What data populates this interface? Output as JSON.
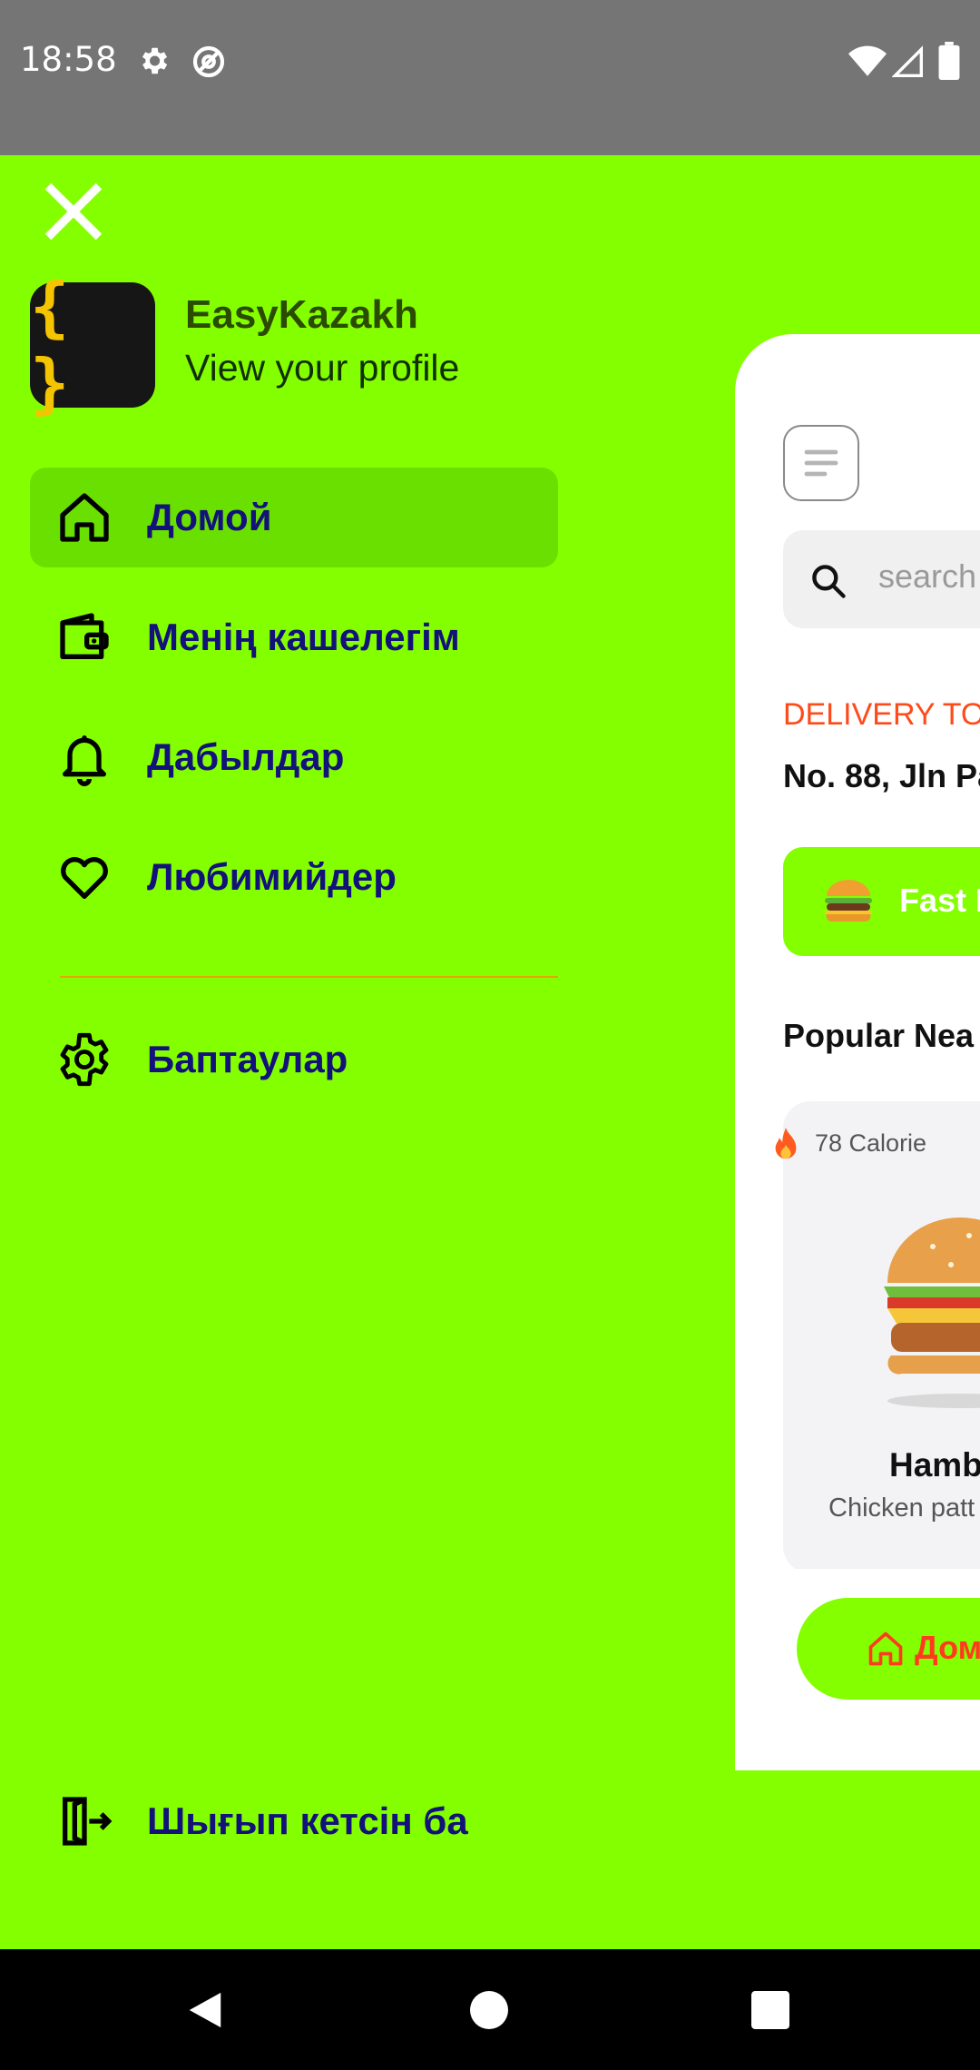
{
  "status_bar": {
    "time": "18:58"
  },
  "drawer": {
    "app_name": "EasyKazakh",
    "profile_link": "View your profile",
    "logo_text": "{ }",
    "menu": [
      {
        "label": "Домой",
        "icon": "home-icon",
        "active": true
      },
      {
        "label": "Менің кашелегім",
        "icon": "wallet-icon",
        "active": false
      },
      {
        "label": "Дабылдар",
        "icon": "bell-icon",
        "active": false
      },
      {
        "label": "Любимийдер",
        "icon": "heart-icon",
        "active": false
      },
      {
        "label": "Баптаулар",
        "icon": "gear-icon",
        "active": false
      }
    ],
    "logout_label": "Шығып кетсін ба"
  },
  "preview": {
    "search_placeholder": "search",
    "delivery_label": "DELIVERY TO",
    "delivery_address": "No. 88, Jln Pa",
    "category_label": "Fast I",
    "section_title": "Popular Nea",
    "food_card": {
      "calories": "78 Calorie",
      "title": "Hamb",
      "description": "Chicken patt"
    },
    "tab_label": "Дом"
  },
  "colors": {
    "accent": "#84ff00",
    "active_menu_bg": "#6ae000",
    "menu_text": "#12127a",
    "delivery_label": "#ff4a1a",
    "logo_bg": "#161616",
    "logo_fg": "#f5c400"
  }
}
